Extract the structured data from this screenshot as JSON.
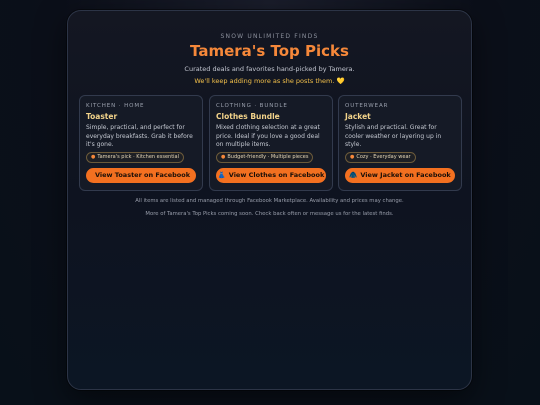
{
  "header": {
    "kicker": "SNOW UNLIMITED FINDS",
    "title": "Tamera's Top Picks",
    "subtitle": "Curated deals and favorites hand-picked by Tamera.",
    "note": "We'll keep adding more as she posts them. 💛"
  },
  "cards": [
    {
      "category": "KITCHEN · HOME",
      "name": "Toaster",
      "description": "Simple, practical, and perfect for everyday breakfasts. Grab it before it's gone.",
      "tag": "Tamera's pick · Kitchen essential",
      "button": "View Toaster on Facebook",
      "button_icon": ""
    },
    {
      "category": "CLOTHING · BUNDLE",
      "name": "Clothes Bundle",
      "description": "Mixed clothing selection at a great price. Ideal if you love a good deal on multiple items.",
      "tag": "Budget-friendly · Multiple pieces",
      "button": "View Clothes on Facebook",
      "button_icon": "👗"
    },
    {
      "category": "OUTERWEAR",
      "name": "Jacket",
      "description": "Stylish and practical. Great for cooler weather or layering up in style.",
      "tag": "Cozy · Everyday wear",
      "button": "View Jacket on Facebook",
      "button_icon": "🧥"
    }
  ],
  "footer": {
    "line1": "All items are listed and managed through Facebook Marketplace. Availability and prices may change.",
    "line2": "More of Tamera's Top Picks coming soon. Check back often or message us for the latest finds."
  },
  "colors": {
    "accent": "#f37020",
    "title": "#f6883a",
    "name": "#f2d38a",
    "note": "#f3c04a"
  }
}
